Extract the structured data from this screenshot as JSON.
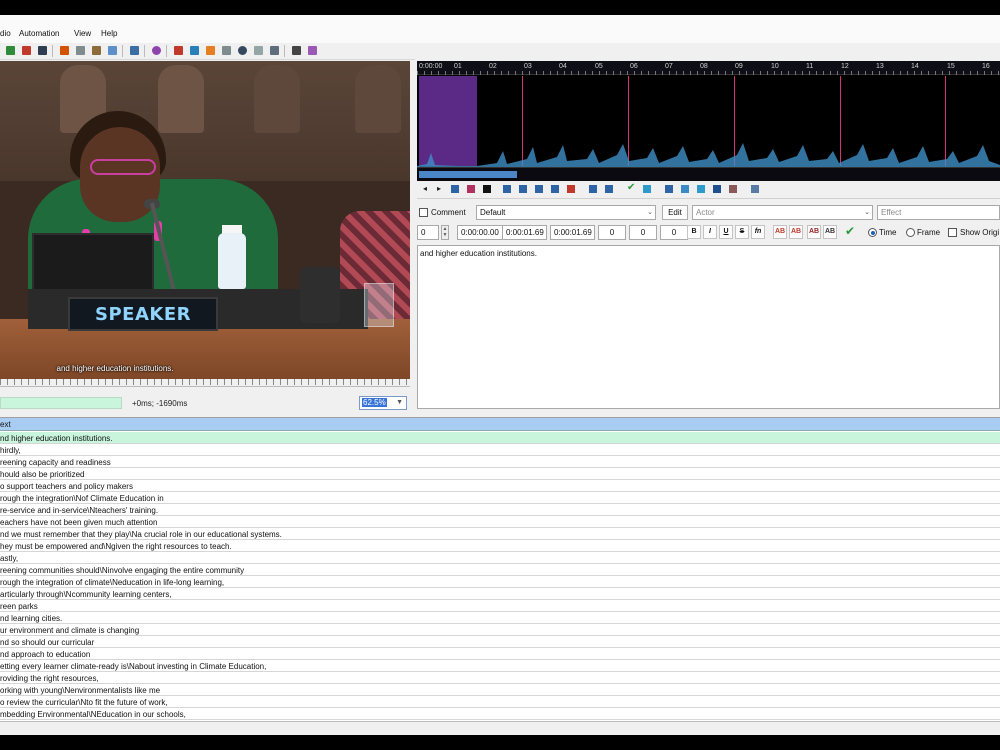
{
  "menu": {
    "items": [
      "dio",
      "Automation",
      "View",
      "Help"
    ]
  },
  "video": {
    "nameplate": "SPEAKER",
    "subtitle": "and higher education institutions.",
    "offset": "+0ms; -1690ms",
    "zoom": "62.5%"
  },
  "audio": {
    "ticks": [
      "0:00:00",
      "01",
      "02",
      "03",
      "04",
      "05",
      "06",
      "07",
      "08",
      "09",
      "10",
      "11",
      "12",
      "13",
      "14",
      "15",
      "16"
    ]
  },
  "edit": {
    "comment_label": "Comment",
    "style": "Default",
    "edit_button": "Edit",
    "actor_placeholder": "Actor",
    "effect_placeholder": "Effect",
    "layer": "0",
    "start_time": "0:00:00.00",
    "end_time": "0:00:01.69",
    "duration": "0:00:01.69",
    "margin_l": "0",
    "margin_r": "0",
    "margin_v": "0",
    "fmt_buttons": [
      "B",
      "I",
      "U",
      "S",
      "fn",
      "AB",
      "AB",
      "AB",
      "AB"
    ],
    "time_label": "Time",
    "frame_label": "Frame",
    "show_original_label": "Show Origi",
    "text": "and higher education institutions."
  },
  "grid": {
    "header": "ext",
    "rows": [
      "nd higher education institutions.",
      "hirdly,",
      "reening capacity and readiness",
      "hould also be prioritized",
      "o support teachers and policy makers",
      "rough the integration\\Nof Climate Education in",
      "re-service and in-service\\Nteachers' training.",
      "eachers have not been given much attention",
      "nd we must remember that they play\\Na crucial role in our educational systems.",
      "hey must be empowered and\\Ngiven the right resources to teach.",
      "astly,",
      "reening communities should\\Ninvolve engaging the entire community",
      "rough the integration of climate\\Neducation in life-long learning,",
      "articularly through\\Ncommunity learning centers,",
      "reen parks",
      "nd learning cities.",
      "ur environment and climate is changing",
      "nd so should our curricular",
      "nd approach to education",
      "etting every learner climate-ready is\\Nabout investing in Climate Education,",
      "roviding the right resources,",
      "orking with young\\Nenvironmentalists like me",
      "o review the curricular\\Nto fit the future of work,",
      "mbedding Environmental\\NEducation in our schools,"
    ]
  }
}
